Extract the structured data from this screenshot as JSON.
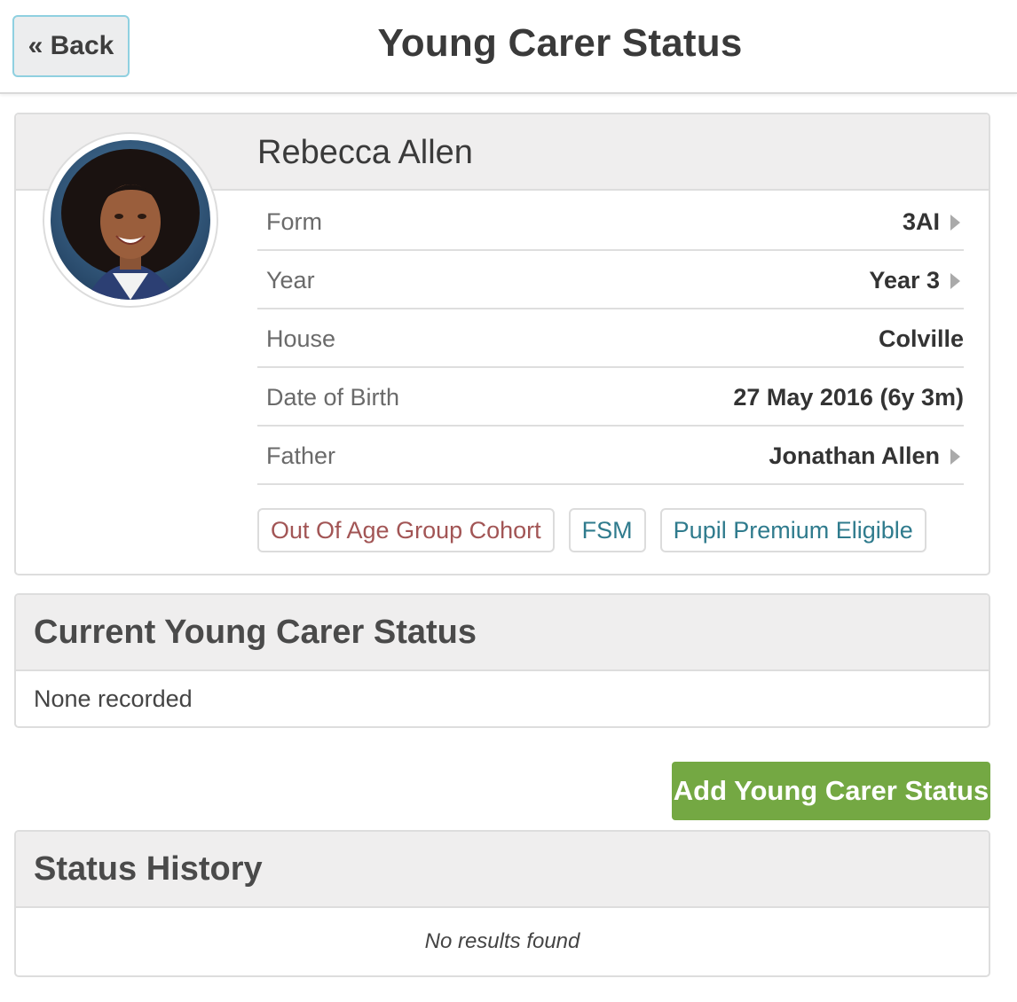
{
  "header": {
    "back_label": "« Back",
    "title": "Young Carer Status"
  },
  "student": {
    "name": "Rebecca Allen",
    "details": [
      {
        "label": "Form",
        "value": "3AI",
        "link": true
      },
      {
        "label": "Year",
        "value": "Year 3",
        "link": true
      },
      {
        "label": "House",
        "value": "Colville",
        "link": false
      },
      {
        "label": "Date of Birth",
        "value": "27 May 2016 (6y 3m)",
        "link": false
      },
      {
        "label": "Father",
        "value": "Jonathan Allen",
        "link": true
      }
    ],
    "tags": [
      {
        "label": "Out Of Age Group Cohort",
        "color": "#a25555"
      },
      {
        "label": "FSM",
        "color": "#2f7b8d"
      },
      {
        "label": "Pupil Premium Eligible",
        "color": "#2f7b8d"
      }
    ]
  },
  "current_status": {
    "title": "Current Young Carer Status",
    "body": "None recorded"
  },
  "add_button": {
    "label": "Add Young Carer Status",
    "color": "#74a843"
  },
  "history": {
    "title": "Status History",
    "empty_text": "No results found"
  },
  "icons": {
    "arrow": "chevron-right-icon"
  }
}
